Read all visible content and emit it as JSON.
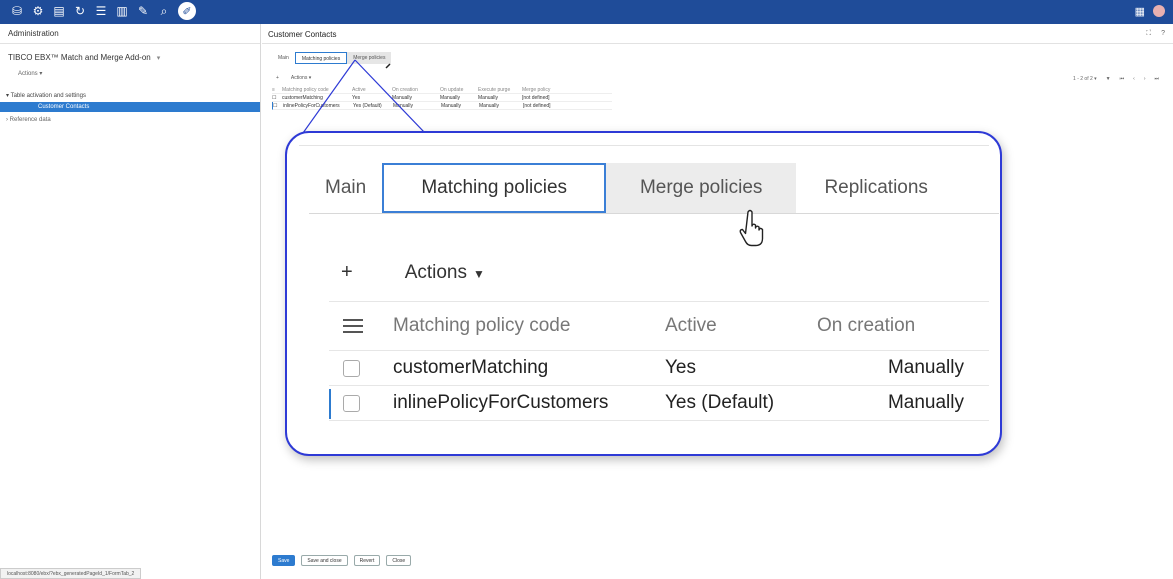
{
  "topbar": {
    "icons": [
      "database-icon",
      "settings-icon",
      "document-icon",
      "refresh-icon",
      "list-icon",
      "book-icon",
      "wrench-icon",
      "search-icon",
      "pencil-icon"
    ],
    "right_icons": [
      "grid-icon",
      "user-icon"
    ],
    "background": "#1f4c99"
  },
  "leftnav": {
    "header": "Administration",
    "module": "TIBCO EBX™ Match and Merge Add-on",
    "actions": "Actions ▾",
    "tree": {
      "group": "Table activation and settings",
      "selected": "Customer Contacts",
      "other": "Reference data"
    },
    "status_url": "localhost:8080/ebx/?ebx_generatedPageId_1/FormTab_2"
  },
  "main": {
    "title": "Customer Contacts",
    "header_icons": [
      "⛶",
      "?"
    ],
    "tabs": [
      "Main",
      "Matching policies",
      "Merge policies",
      "Replications"
    ],
    "actions": "Actions ▾",
    "plus": "+",
    "pager": {
      "range": "1 - 2 of 2 ▾",
      "nav": [
        "⏮",
        "‹",
        "›",
        "⏭"
      ]
    },
    "columns": [
      "Matching policy code",
      "Active",
      "On creation",
      "On update",
      "Execute purge",
      "Merge policy"
    ],
    "rows": [
      {
        "code": "customerMatching",
        "active": "Yes",
        "on_creation": "Manually",
        "on_update": "Manually",
        "execute_purge": "Manually",
        "merge_policy": "[not defined]"
      },
      {
        "code": "inlinePolicyForCustomers",
        "active": "Yes (Default)",
        "on_creation": "Manually",
        "on_update": "Manually",
        "execute_purge": "Manually",
        "merge_policy": "[not defined]"
      }
    ],
    "footer_buttons": [
      "Save",
      "Save and close",
      "Revert",
      "Close"
    ]
  },
  "zoom": {
    "tabs": [
      "Main",
      "Matching policies",
      "Merge policies",
      "Replications"
    ],
    "actions": "Actions",
    "caret": "▼",
    "plus": "+",
    "columns": [
      "Matching policy code",
      "Active",
      "On creation"
    ],
    "rows": [
      {
        "code": "customerMatching",
        "active": "Yes",
        "on_creation": "Manually"
      },
      {
        "code": "inlinePolicyForCustomers",
        "active": "Yes (Default)",
        "on_creation": "Manually"
      }
    ],
    "border_color": "#2e3ad6",
    "accent": "#2d7bcf"
  }
}
